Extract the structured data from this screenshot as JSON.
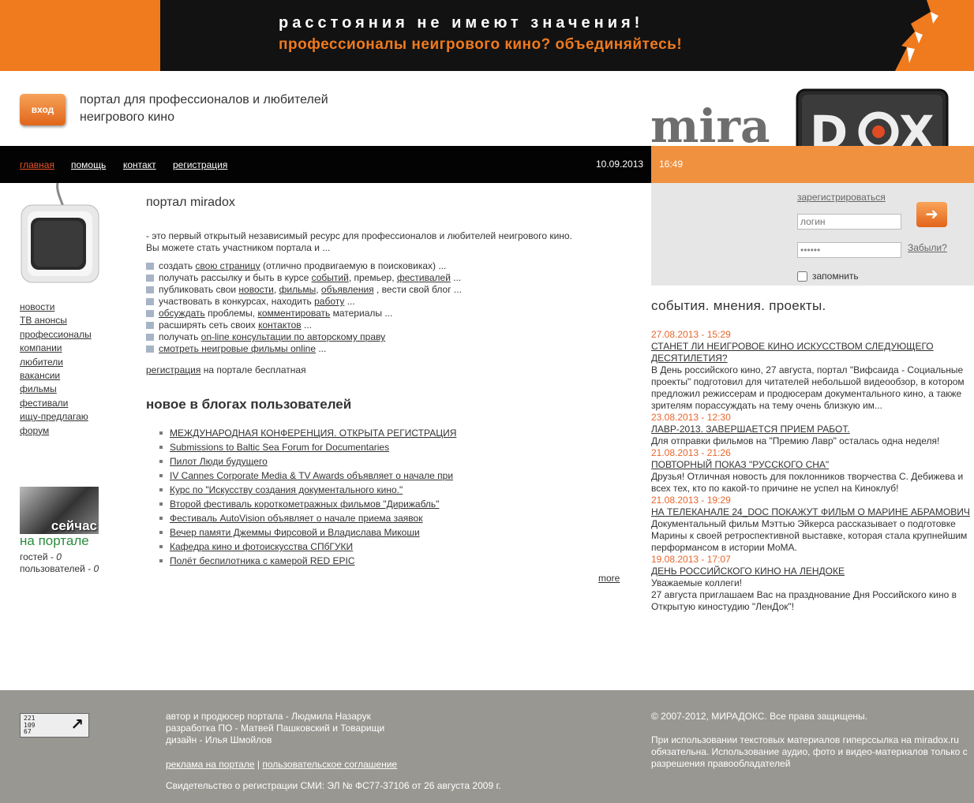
{
  "banner": {
    "line1": "расстояния не имеют значения!",
    "line2": "профессионалы неигрового кино? объединяйтесь!"
  },
  "header": {
    "login_label": "вход",
    "tagline1": "портал для профессионалов и любителей",
    "tagline2": "неигрового кино",
    "logo_left": "mira",
    "logo_right_1": "D",
    "logo_right_2": "X"
  },
  "nav": {
    "items": [
      "главная",
      "помощь",
      "контакт",
      "регистрация"
    ],
    "date": "10.09.2013",
    "time": "16:49"
  },
  "sidebar": {
    "items": [
      "новости",
      "ТВ анонсы",
      "профессионалы",
      "компании",
      "любители",
      "вакансии",
      "фильмы",
      "фестивали",
      "ищу-предлагаю",
      "форум"
    ],
    "now_label": "сейчас",
    "on_portal": "на портале",
    "guests_label": "гостей - ",
    "guests_count": "0",
    "users_label": "пользователей - ",
    "users_count": "0"
  },
  "main": {
    "title": "портал miradox",
    "intro1": "- это первый открытый независимый ресурс для профессионалов и любителей неигрового кино.",
    "intro2": "Вы можете стать участником портала и ...",
    "features": [
      {
        "pre": "создать ",
        "link1": "свою страницу",
        "mid1": " (отлично продвигаемую в поисковиках) ...",
        "link2": "",
        "mid2": "",
        "link3": "",
        "post": ""
      },
      {
        "pre": "получать рассылку и быть в курсе ",
        "link1": "событий",
        "mid1": ", премьер, ",
        "link2": "фестивалей",
        "mid2": " ...",
        "link3": "",
        "post": ""
      },
      {
        "pre": "публиковать свои ",
        "link1": "новости",
        "mid1": ", ",
        "link2": "фильмы",
        "mid2": ", ",
        "link3": "объявления",
        "post": " , вести свой блог ..."
      },
      {
        "pre": "участвовать в конкурсах, находить ",
        "link1": "работу",
        "mid1": " ...",
        "link2": "",
        "mid2": "",
        "link3": "",
        "post": ""
      },
      {
        "pre": "",
        "link1": "обсуждать",
        "mid1": " проблемы, ",
        "link2": "комментировать",
        "mid2": " материалы  ...",
        "link3": "",
        "post": ""
      },
      {
        "pre": "расширять сеть своих ",
        "link1": "контактов",
        "mid1": " ...",
        "link2": "",
        "mid2": "",
        "link3": "",
        "post": ""
      },
      {
        "pre": "получать ",
        "link1": "on-line консультации по авторскому праву",
        "mid1": "",
        "link2": "",
        "mid2": "",
        "link3": "",
        "post": ""
      },
      {
        "pre": "",
        "link1": "смотреть неигровые фильмы online",
        "mid1": " ...",
        "link2": "",
        "mid2": "",
        "link3": "",
        "post": ""
      }
    ],
    "free_link": "регистрация",
    "free_text": " на портале бесплатная",
    "blogs_title": "новое в блогах пользователей",
    "blogs": [
      "МЕЖДУНАРОДНАЯ КОНФЕРЕНЦИЯ. ОТКРЫТА РЕГИСТРАЦИЯ",
      "Submissions to Baltic Sea Forum for Documentaries",
      "Пилот Люди будущего",
      "IV Cannes Corporate Media & TV Awards объявляет о начале при",
      "Курс по \"Искусству создания документального кино.\"",
      "Второй фестиваль короткометражных фильмов \"Дирижабль\"",
      "Фестиваль AutoVision объявляет о начале приема заявок",
      "Вечер памяти Джеммы Фирсовой и Владислава Микоши",
      "Кафедра кино и фотоискусства СПбГУКИ",
      "Полёт беспилотника с камерой RED EPIC"
    ],
    "more": "more"
  },
  "login": {
    "register": "зарегистрироваться",
    "login_placeholder": "логин",
    "password_value": "••••••",
    "forgot": "Забыли?",
    "remember": "запомнить"
  },
  "events": {
    "title": "события. мнения. проекты.",
    "items": [
      {
        "date": "27.08.2013 - 15:29",
        "title": "Станет ли неигровое кино искусством следующего десятилетия?",
        "body": "В День российского кино, 27 августа, портал \"Вифсаида - Социальные проекты\" подготовил для читателей небольшой видеообзор, в котором предложил режиссерам и продюсерам документального кино, а также зрителям порассуждать на тему очень близкую им..."
      },
      {
        "date": "23.08.2013 - 12:30",
        "title": "ЛАВР-2013. Завершается прием работ.",
        "body": "Для отправки фильмов на \"Премию Лавр\" осталась одна неделя!"
      },
      {
        "date": "21.08.2013 - 21:26",
        "title": "Повторный показ \"Русского сна\"",
        "body": " Друзья! Отличная новость для поклонников творчества С. Дебижева и всех тех, кто по какой-то причине не успел на Киноклуб!"
      },
      {
        "date": "21.08.2013 - 19:29",
        "title": "На телеканале 24_DOC покажут фильм о Марине Абрамович",
        "body": "Документальный фильм Мэттью Эйкерса рассказывает о подготовке Марины к своей ретроспективной выставке, которая стала крупнейшим перформансом в истории MoMA."
      },
      {
        "date": "19.08.2013 - 17:07",
        "title": "День Российского кино на ЛенДоке",
        "body": "Уважаемые коллеги!\n27 августа приглашаем Вас на празднование Дня Российского кино в Открытую киностудию \"ЛенДок\"!"
      }
    ]
  },
  "footer": {
    "counter_digits": "221\n109\n67",
    "credit1": "автор и продюсер портала - Людмила Назарук",
    "credit2": "разработка ПО - Матвей Пашковский и Товарищи",
    "credit3": "дизайн - Илья Шмойлов",
    "link_ads": "реклама на портале",
    "separator": " | ",
    "link_terms": "пользовательское соглашение",
    "certificate": "Свидетельство о регистрации СМИ: ЭЛ № ФС77-37106 от 26 августа 2009 г.",
    "copyright": "© 2007-2012, МИРАДОКС. Все права защищены.",
    "usage": "При использовании текстовых материалов гиперссылка на miradox.ru обязательна. Использование аудио, фото и видео-материалов только с разрешения правообладателей"
  },
  "colors": {
    "orange": "#f07a1e",
    "nav_active": "#e8542a",
    "event_date": "#e8662b",
    "footer_bg": "#999792",
    "green": "#2b8c3e"
  }
}
